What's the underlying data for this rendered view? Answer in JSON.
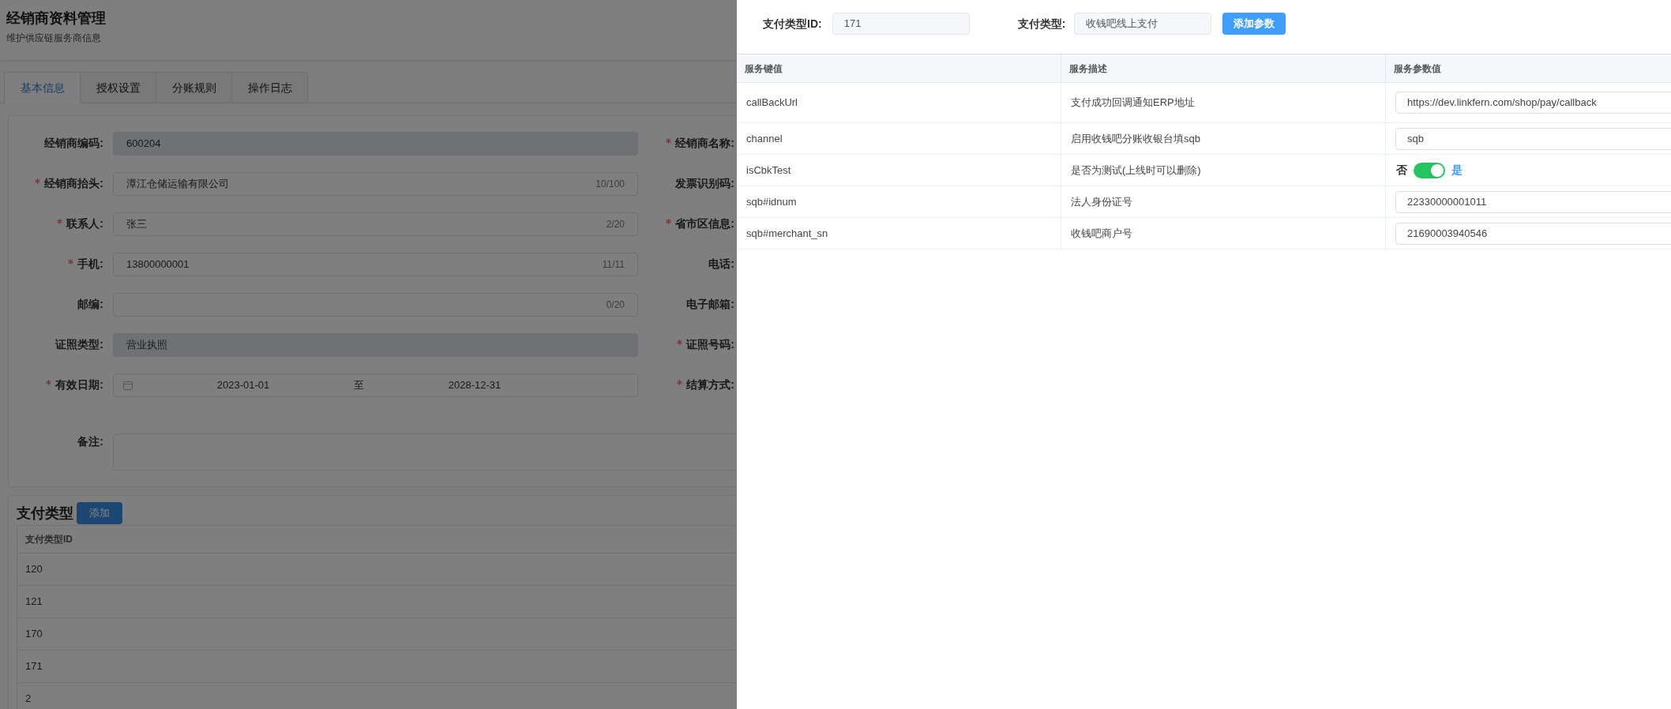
{
  "page": {
    "title": "经销商资料管理",
    "subtitle": "维护供应链服务商信息"
  },
  "tabs": [
    {
      "label": "基本信息",
      "selected": true
    },
    {
      "label": "授权设置",
      "selected": false
    },
    {
      "label": "分账规则",
      "selected": false
    },
    {
      "label": "操作日志",
      "selected": false
    }
  ],
  "form": {
    "rows": [
      {
        "kind": "text",
        "label": "经销商编码:",
        "required": false,
        "value": "600204",
        "readonly": true,
        "right_label": "经销商名称:",
        "right_required": true
      },
      {
        "kind": "text",
        "label": "经销商抬头:",
        "required": true,
        "value": "潭江仓储运输有限公司",
        "counter": "10/100",
        "readonly": false,
        "right_label": "发票识别码:",
        "right_required": false
      },
      {
        "kind": "text",
        "label": "联系人:",
        "required": true,
        "value": "张三",
        "counter": "2/20",
        "readonly": false,
        "right_label": "省市区信息:",
        "right_required": true
      },
      {
        "kind": "text",
        "label": "手机:",
        "required": true,
        "value": "13800000001",
        "counter": "11/11",
        "readonly": false,
        "right_label": "电话:",
        "right_required": false
      },
      {
        "kind": "text",
        "label": "邮编:",
        "required": false,
        "counter": "0/20",
        "readonly": false,
        "right_label": "电子邮箱:",
        "right_required": false
      },
      {
        "kind": "text",
        "label": "证照类型:",
        "required": false,
        "value": "营业执照",
        "readonly": true,
        "right_label": "证照号码:",
        "right_required": true
      },
      {
        "kind": "date_range",
        "label": "有效日期:",
        "required": true,
        "start": "2023-01-01",
        "separator": "至",
        "end": "2028-12-31",
        "right_label": "结算方式:",
        "right_required": true
      },
      {
        "kind": "textarea",
        "label": "备注:",
        "required": false
      }
    ]
  },
  "payment": {
    "title": "支付类型",
    "add_button": "添加",
    "columns": [
      "支付类型ID"
    ],
    "rows": [
      "120",
      "121",
      "170",
      "171",
      "2"
    ]
  },
  "drawer": {
    "id_label": "支付类型ID:",
    "id_value": "171",
    "type_label": "支付类型:",
    "type_value": "收钱吧线上支付",
    "add_button": "添加参数",
    "columns": [
      "服务键值",
      "服务描述",
      "服务参数值"
    ],
    "rows": [
      {
        "key": "callBackUrl",
        "description": "支付成功回调通知ERP地址",
        "kind": "input",
        "value": "https://dev.linkfern.com/shop/pay/callback"
      },
      {
        "key": "channel",
        "description": "启用收钱吧分账收银台填sqb",
        "kind": "input",
        "value": "sqb"
      },
      {
        "key": "isCbkTest",
        "description": "是否为测试(上线时可以删除)",
        "kind": "switch",
        "off_label": "否",
        "on_label": "是",
        "on": true
      },
      {
        "key": "sqb#idnum",
        "description": "法人身份证号",
        "kind": "input",
        "value": "22330000001011"
      },
      {
        "key": "sqb#merchant_sn",
        "description": "收钱吧商户号",
        "kind": "input",
        "value": "21690003940546"
      }
    ]
  }
}
